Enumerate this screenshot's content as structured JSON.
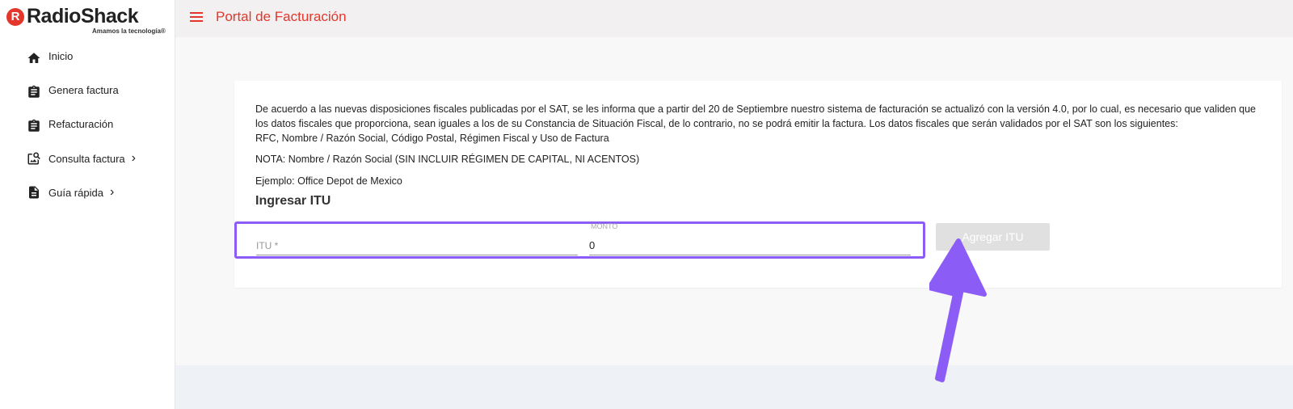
{
  "brand": {
    "logo_mark": "R",
    "logo_word": "RadioShack",
    "tagline": "Amamos la tecnología®"
  },
  "sidebar": {
    "items": [
      {
        "label": "Inicio",
        "icon": "home-icon"
      },
      {
        "label": "Genera factura",
        "icon": "clipboard-icon"
      },
      {
        "label": "Refacturación",
        "icon": "clipboard-icon"
      },
      {
        "label": "Consulta factura",
        "icon": "image-search-icon",
        "chevron": "›"
      },
      {
        "label": "Guía rápida",
        "icon": "document-icon",
        "chevron": "›"
      }
    ]
  },
  "header": {
    "title": "Portal de Facturación"
  },
  "card": {
    "paragraph1": "De acuerdo a las nuevas disposiciones fiscales publicadas por el SAT, se les informa que a partir del 20 de Septiembre nuestro sistema de facturación se actualizó con la versión 4.0, por lo cual, es necesario que validen que los datos fiscales que proporciona, sean iguales a los de su Constancia de Situación Fiscal, de lo contrario, no se podrá emitir la factura. Los datos fiscales que serán validados por el SAT son los siguientes:",
    "paragraph1b": "RFC, Nombre / Razón Social, Código Postal, Régimen Fiscal y Uso de Factura",
    "note": "NOTA: Nombre / Razón Social (SIN INCLUIR RÉGIMEN DE CAPITAL, NI ACENTOS)",
    "example": "Ejemplo: Office Depot de Mexico",
    "section_title": "Ingresar ITU",
    "itu_field": {
      "placeholder": "ITU *",
      "value": ""
    },
    "monto_field": {
      "label": "MONTO",
      "value": "0"
    },
    "add_button": "Agregar ITU"
  },
  "colors": {
    "brand_red": "#e4362b",
    "highlight": "#8b5cf6",
    "button_disabled": "#e0e0e0"
  }
}
